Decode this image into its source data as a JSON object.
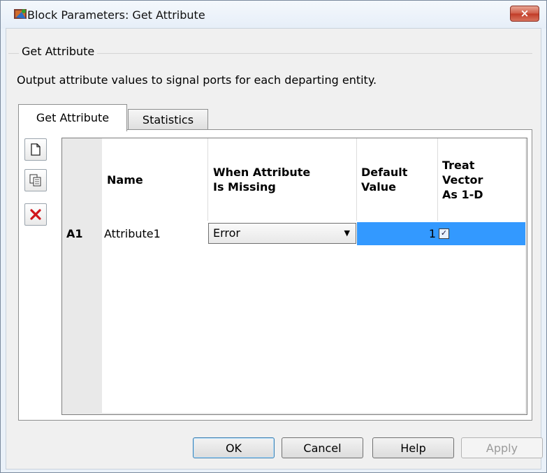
{
  "window": {
    "title": "Block Parameters: Get Attribute",
    "close_label": "×"
  },
  "group": {
    "title": "Get Attribute",
    "description": "Output attribute values to signal ports for each departing entity."
  },
  "tabs": [
    {
      "label": "Get Attribute",
      "active": true
    },
    {
      "label": "Statistics",
      "active": false
    }
  ],
  "toolbar": [
    {
      "name": "new-row",
      "icon": "new-document-icon",
      "glyph": "🗋"
    },
    {
      "name": "copy-row",
      "icon": "copy-icon",
      "glyph": "⎘"
    },
    {
      "name": "delete-row",
      "icon": "delete-icon",
      "glyph": "✖"
    }
  ],
  "table": {
    "columns": [
      {
        "label": "Name"
      },
      {
        "label": "When Attribute Is Missing",
        "line1": "When Attribute",
        "line2": "Is Missing"
      },
      {
        "label": "Default Value",
        "line1": "Default",
        "line2": "Value"
      },
      {
        "label": "Treat Vector As 1-D",
        "line1": "Treat",
        "line2": "Vector",
        "line3": "As 1-D"
      }
    ],
    "rows": [
      {
        "row_label": "A1",
        "name": "Attribute1",
        "when_missing": "Error",
        "default_value": "1",
        "treat_vector_1d": true
      }
    ]
  },
  "buttons": {
    "ok": "OK",
    "cancel": "Cancel",
    "help": "Help",
    "apply": "Apply"
  },
  "colors": {
    "selection": "#3399ff",
    "close_button": "#c13a26"
  }
}
